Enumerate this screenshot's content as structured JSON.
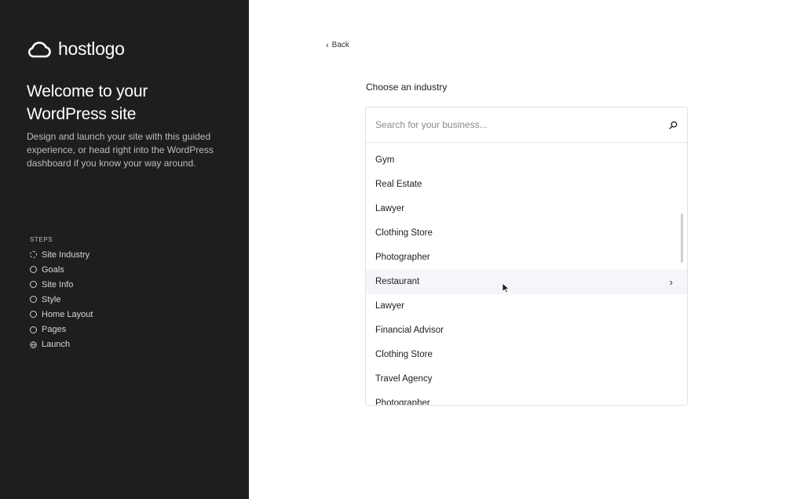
{
  "brand": {
    "name": "hostlogo",
    "icon": "cloud-icon"
  },
  "sidebar": {
    "title": "Welcome to your WordPress site",
    "description": "Design and launch your site with this guided experience, or head right into the WordPress dashboard if you know your way around.",
    "steps_label": "STEPS",
    "steps": [
      {
        "label": "Site Industry",
        "icon": "dashed-circle-icon",
        "status": "current"
      },
      {
        "label": "Goals",
        "icon": "circle-icon",
        "status": "pending"
      },
      {
        "label": "Site Info",
        "icon": "circle-icon",
        "status": "pending"
      },
      {
        "label": "Style",
        "icon": "circle-icon",
        "status": "pending"
      },
      {
        "label": "Home Layout",
        "icon": "circle-icon",
        "status": "pending"
      },
      {
        "label": "Pages",
        "icon": "circle-icon",
        "status": "pending"
      },
      {
        "label": "Launch",
        "icon": "globe-icon",
        "status": "pending"
      }
    ]
  },
  "main": {
    "back_label": "Back",
    "heading": "Choose an industry",
    "search": {
      "placeholder": "Search for your business...",
      "value": ""
    },
    "industries": [
      {
        "label": "Gym"
      },
      {
        "label": "Real Estate"
      },
      {
        "label": "Lawyer"
      },
      {
        "label": "Clothing Store"
      },
      {
        "label": "Photographer"
      },
      {
        "label": "Restaurant",
        "hovered": true
      },
      {
        "label": "Lawyer"
      },
      {
        "label": "Financial Advisor"
      },
      {
        "label": "Clothing Store"
      },
      {
        "label": "Travel Agency"
      },
      {
        "label": "Photographer"
      }
    ]
  },
  "colors": {
    "sidebar_bg": "#1e1e1e",
    "hover_bg": "#f5f6fa",
    "border": "#e2e2e2"
  }
}
